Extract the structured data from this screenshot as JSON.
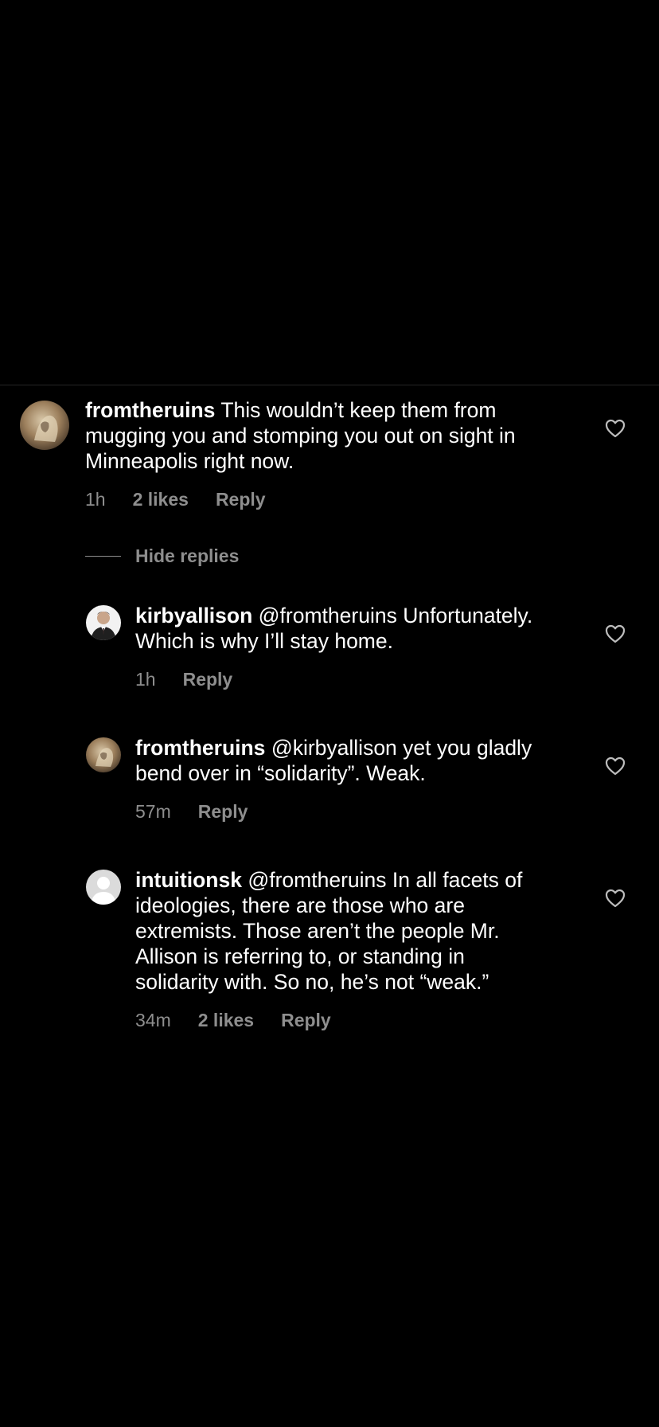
{
  "comments": [
    {
      "username": "fromtheruins",
      "text": "This wouldn’t keep them from",
      "line2": "mugging you and stomping you out on sight in",
      "line3": "Minneapolis right now.",
      "time": "1h",
      "likes": "2 likes",
      "reply": "Reply",
      "avatar": "marble-statue-avatar"
    }
  ],
  "thread": {
    "hide_replies": "Hide replies"
  },
  "replies": [
    {
      "username": "kirbyallison",
      "line1_rest": "@fromtheruins Unfortunately.",
      "line2": "Which is why I’ll stay home.",
      "time": "1h",
      "reply": "Reply",
      "avatar": "man-in-suit-avatar"
    },
    {
      "username": "fromtheruins",
      "line1_rest": "@kirbyallison yet you gladly",
      "line2": "bend over in “solidarity”. Weak.",
      "time": "57m",
      "reply": "Reply",
      "avatar": "marble-statue-avatar"
    },
    {
      "username": "intuitionsk",
      "line1_rest": "@fromtheruins In all facets of",
      "line2": "ideologies, there are those who are",
      "line3": "extremists. Those aren’t the people Mr.",
      "line4": "Allison is referring to, or standing in",
      "line5": "solidarity with. So no, he’s not “weak.”",
      "time": "34m",
      "likes": "2 likes",
      "reply": "Reply",
      "avatar": "default-avatar"
    }
  ],
  "colors": {
    "background": "#000000",
    "text": "#ffffff",
    "muted": "#8e8e8e",
    "divider": "#262626"
  }
}
